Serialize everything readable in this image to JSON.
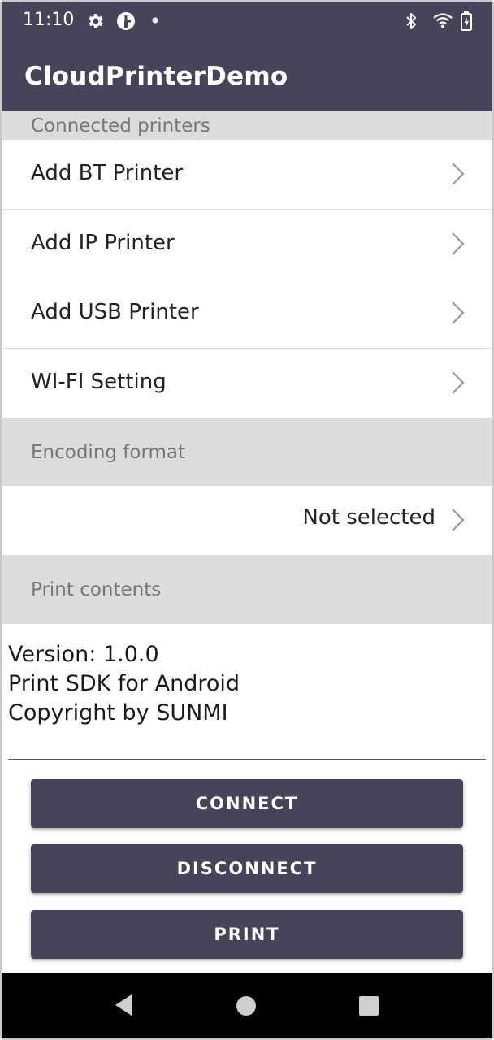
{
  "status_bar": {
    "time": "11:10",
    "icons": [
      "gear-icon",
      "data-saver-icon",
      "dot-icon",
      "bluetooth-icon",
      "wifi-icon",
      "battery-icon"
    ]
  },
  "app_bar": {
    "title": "CloudPrinterDemo"
  },
  "sections": {
    "connected_printers": "Connected printers",
    "encoding_format": "Encoding format",
    "print_contents": "Print contents"
  },
  "printer_items": [
    {
      "label": "Add BT Printer"
    },
    {
      "label": "Add IP Printer"
    },
    {
      "label": "Add USB Printer"
    },
    {
      "label": "WI-FI Setting"
    }
  ],
  "encoding": {
    "value": "Not selected"
  },
  "contents": {
    "line1": "Version: 1.0.0",
    "line2": "Print SDK for Android",
    "line3": "Copyright by SUNMI"
  },
  "buttons": {
    "connect": "CONNECT",
    "disconnect": "DISCONNECT",
    "print": "PRINT"
  },
  "nav_bar": {
    "icons": [
      "back-icon",
      "home-icon",
      "recents-icon"
    ]
  },
  "colors": {
    "primary": "#454459",
    "section_bg": "#dcdcdc",
    "section_text": "#767676"
  }
}
